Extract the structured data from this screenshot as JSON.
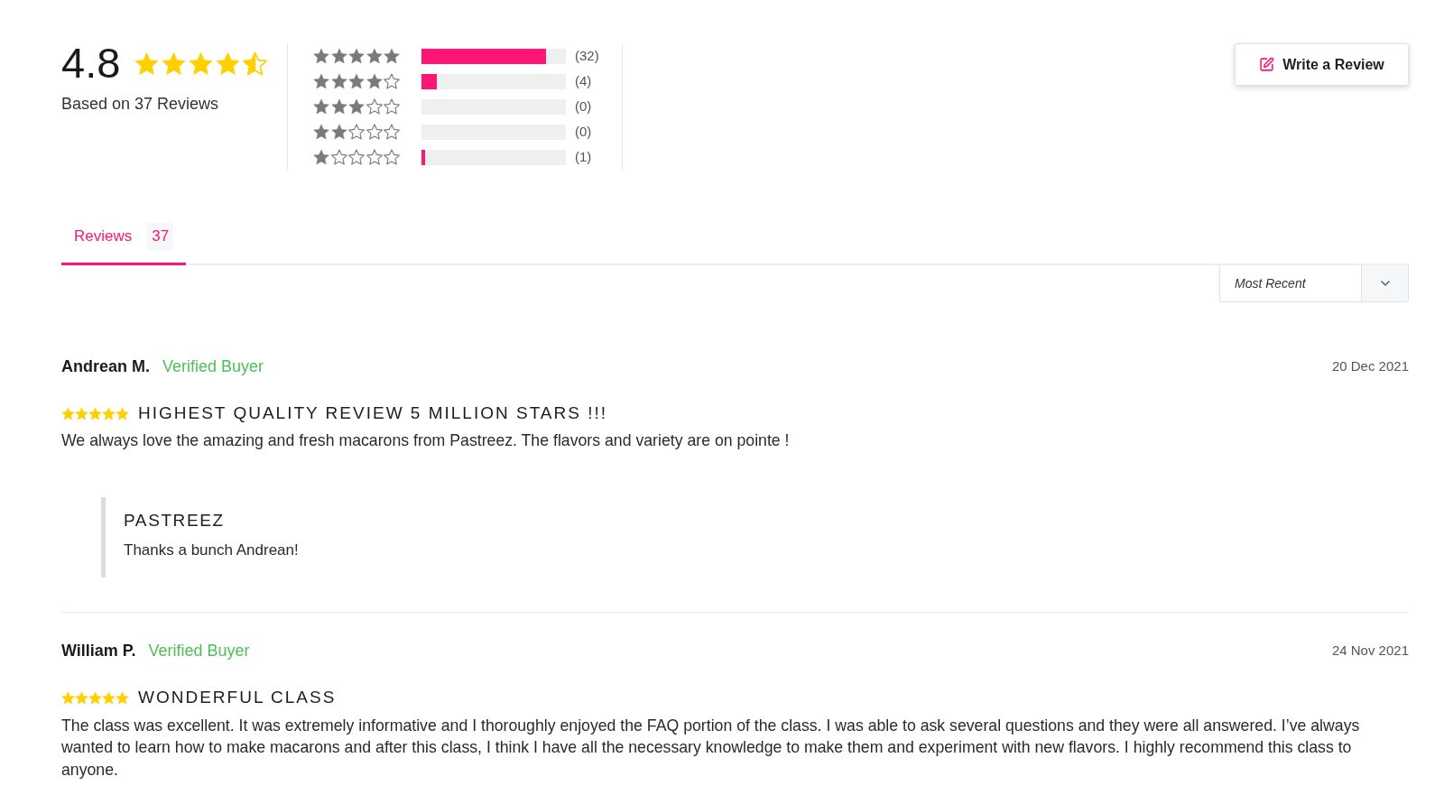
{
  "summary": {
    "rating": "4.8",
    "stars": 4.5,
    "caption": "Based on 37 Reviews"
  },
  "histogram": [
    {
      "stars": 5,
      "level": 0.865,
      "count": "(32)"
    },
    {
      "stars": 4,
      "level": 0.108,
      "count": "(4)"
    },
    {
      "stars": 3,
      "level": 0,
      "count": "(0)"
    },
    {
      "stars": 2,
      "level": 0,
      "count": "(0)"
    },
    {
      "stars": 1,
      "level": 0.027,
      "count": "(1)"
    }
  ],
  "write_review_button": {
    "label": "Write a Review"
  },
  "tabs": [
    {
      "label": "Reviews",
      "count": "37",
      "selected": true
    }
  ],
  "sort": {
    "value": "Most Recent"
  },
  "reviews": [
    {
      "author": "Andrean M.",
      "badge": "Verified Buyer",
      "date": "20 Dec 2021",
      "stars": 5,
      "title": "HIGHEST QUALITY REVIEW 5 MILLION STARS !!!",
      "body": "We always love the amazing and fresh macarons from Pastreez. The flavors and variety are on pointe !",
      "reply": {
        "author": "PASTREEZ",
        "text": "Thanks a bunch Andrean!"
      }
    },
    {
      "author": "William P.",
      "badge": "Verified Buyer",
      "date": "24 Nov 2021",
      "stars": 5,
      "title": "WONDERFUL CLASS",
      "body": "The class was excellent. It was extremely informative and I thoroughly enjoyed the FAQ portion of the class. I was able to ask several questions and they were all answered. I’ve always wanted to learn how to make macarons and after this class, I think I have all the necessary knowledge to make them and experiment with new flavors. I highly recommend this class to anyone."
    }
  ]
}
